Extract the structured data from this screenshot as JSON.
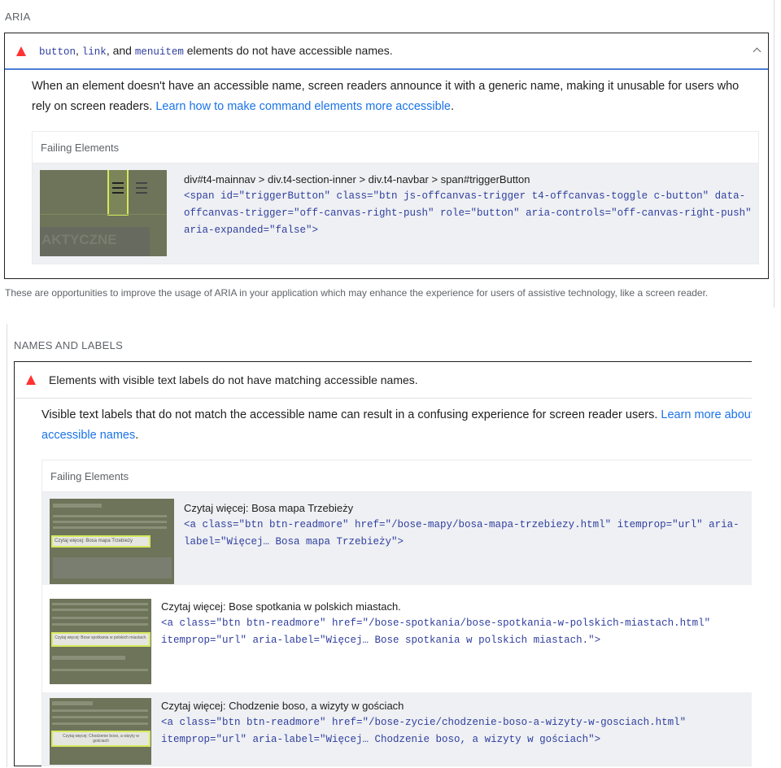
{
  "aria": {
    "group_title": "ARIA",
    "audit": {
      "title_code": [
        "button",
        "link",
        "menuitem"
      ],
      "title_sep1": ", ",
      "title_sep2": ", and ",
      "title_rest": " elements do not have accessible names.",
      "description": "When an element doesn't have an accessible name, screen readers announce it with a generic name, making it unusable for users who rely on screen readers. ",
      "learn_link": "Learn how to make command elements more accessible",
      "desc_end": ".",
      "table_header": "Failing Elements",
      "items": [
        {
          "selector": "div#t4-mainnav > div.t4-section-inner > div.t4-navbar > span#triggerButton",
          "snippet": "<span id=\"triggerButton\" class=\"btn js-offcanvas-trigger t4-offcanvas-toggle c-button\" data-offcanvas-trigger=\"off-canvas-right-push\" role=\"button\" aria-controls=\"off-canvas-right-push\" aria-expanded=\"false\">",
          "thumb_text": "AKTYCZNE"
        }
      ]
    },
    "footer": "These are opportunities to improve the usage of ARIA in your application which may enhance the experience for users of assistive technology, like a screen reader."
  },
  "names": {
    "group_title": "NAMES AND LABELS",
    "audit": {
      "title": "Elements with visible text labels do not have matching accessible names.",
      "description": "Visible text labels that do not match the accessible name can result in a confusing experience for screen reader users. ",
      "learn_link": "Learn more about accessible names",
      "desc_end": ".",
      "table_header": "Failing Elements",
      "items": [
        {
          "selector": "Czytaj więcej: Bosa mapa Trzebieży",
          "snippet": "<a class=\"btn btn-readmore\" href=\"/bose-mapy/bosa-mapa-trzebiezy.html\" itemprop=\"url\" aria-label=\"Więcej… Bosa mapa Trzebieży\">",
          "thumb_label": "Czytaj więcej: Bosa mapa Trzebieży"
        },
        {
          "selector": "Czytaj więcej: Bose spotkania w polskich miastach.",
          "snippet": "<a class=\"btn btn-readmore\" href=\"/bose-spotkania/bose-spotkania-w-polskich-miastach.html\" itemprop=\"url\" aria-label=\"Więcej… Bose spotkania w polskich miastach.\">",
          "thumb_label": "Czytaj więcej: Bose spotkania w polskich miastach."
        },
        {
          "selector": "Czytaj więcej: Chodzenie boso, a wizyty w gościach",
          "snippet": "<a class=\"btn btn-readmore\" href=\"/bose-zycie/chodzenie-boso-a-wizyty-w-gosciach.html\" itemprop=\"url\" aria-label=\"Więcej… Chodzenie boso, a wizyty w gościach\">",
          "thumb_label": "Czytaj więcej: Chodzenie boso, a wizyty w gościach"
        }
      ]
    }
  }
}
